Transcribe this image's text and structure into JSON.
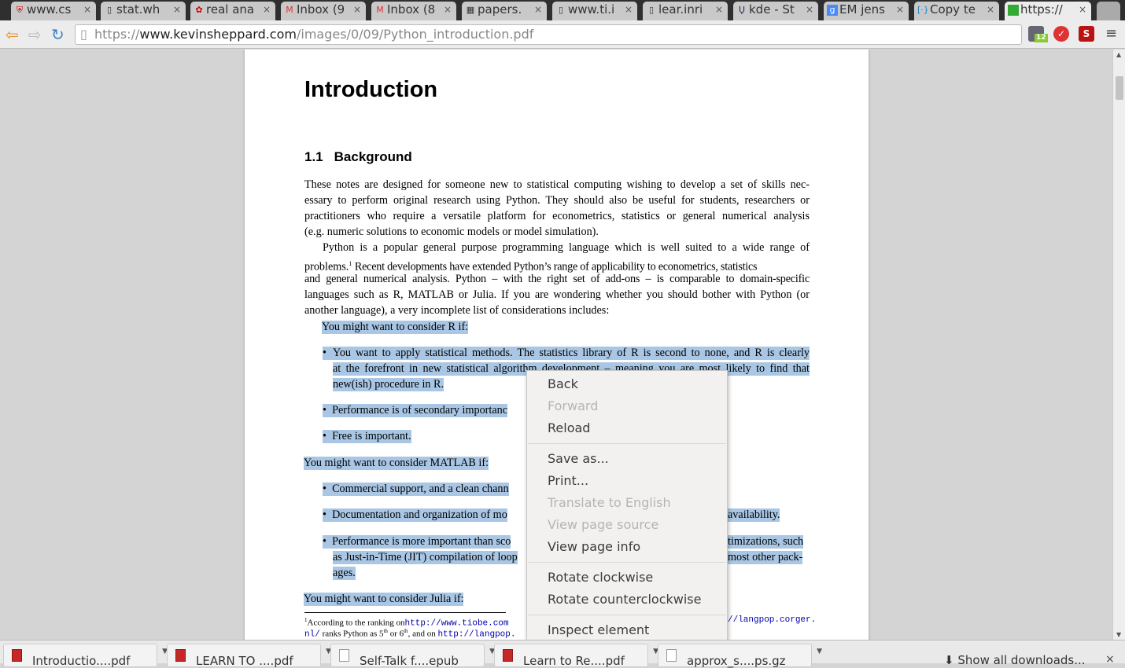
{
  "tabs": [
    {
      "title": "www.cs",
      "icon": "shield-icon"
    },
    {
      "title": "stat.wh",
      "icon": "page-icon"
    },
    {
      "title": "real ana",
      "icon": "flower-icon"
    },
    {
      "title": "Inbox (9",
      "icon": "gmail-icon"
    },
    {
      "title": "Inbox (8",
      "icon": "gmail-icon"
    },
    {
      "title": "papers.",
      "icon": "image-icon"
    },
    {
      "title": "www.ti.i",
      "icon": "page-icon"
    },
    {
      "title": "lear.inri",
      "icon": "page-icon"
    },
    {
      "title": "kde - St",
      "icon": "ul-icon"
    },
    {
      "title": "EM jens",
      "icon": "google-icon"
    },
    {
      "title": "Copy te",
      "icon": "bracket-icon"
    },
    {
      "title": "https://",
      "icon": "green-squares-icon",
      "active": true
    }
  ],
  "address": {
    "scheme": "https://",
    "domain": "www.kevinsheppard.com",
    "path": "/images/0/09/Python_introduction.pdf"
  },
  "extensions": {
    "badge": "12",
    "s_label": "S"
  },
  "doc": {
    "title": "Introduction",
    "section_num": "1.1",
    "section_title": "Background",
    "p1": [
      "These notes are designed for someone new to statistical computing wishing to develop a set of skills nec-",
      "essary to perform original research using Python. They should also be useful for students, researchers or",
      "practitioners who require a versatile platform for econometrics, statistics or general numerical analysis",
      "(e.g. numeric solutions to economic models or model simulation)."
    ],
    "p2": [
      "Python is a popular general purpose programming language which is well suited to a wide range of",
      "problems.",
      "1",
      "Recent developments have extended Python’s range of applicability to econometrics, statistics",
      "and general numerical analysis. Python – with the right set of add-ons – is comparable to domain-specific",
      "languages such as R, MATLAB or Julia. If you are wondering whether you should bother with Python (or",
      "another language), a very incomplete list of considerations includes:"
    ],
    "r_intro": "You might want to consider R if:",
    "r_b1": [
      "You want to apply statistical methods. The statistics library of R is second to none, and R is clearly",
      "at the forefront in new statistical algorithm development – meaning you are most likely to find that",
      "new(ish) procedure in R."
    ],
    "r_b2": "Performance is of secondary importanc",
    "r_b3": "Free is important.",
    "m_intro": "You might want to consider MATLAB if:",
    "m_b1": "Commercial support, and a clean chann",
    "m_b2_l": "Documentation and organization of mo",
    "m_b2_r": "availability.",
    "m_b3_l": [
      "Performance is more important than sco",
      "as Just-in-Time (JIT) compilation of loop",
      "ages."
    ],
    "m_b3_r": [
      "timizations, such",
      "most other pack-"
    ],
    "j_intro": "You might want to consider Julia if:",
    "fn1_a": "According to the ranking on",
    "fn1_url": "http://www.tiobe.com",
    "fn1_url2": "//langpop.corger.",
    "fn2_a": "nl/",
    "fn2_b": " ranks Python as 5",
    "fn2_th": "th",
    "fn2_c": " or 6",
    "fn2_d": ", and on ",
    "fn2_url": "http://langpop."
  },
  "context_menu": [
    "Back",
    "Forward",
    "Reload",
    "Save as...",
    "Print...",
    "Translate to English",
    "View page source",
    "View page info",
    "Rotate clockwise",
    "Rotate counterclockwise",
    "Inspect element"
  ],
  "downloads": [
    {
      "name": "Introductio....pdf",
      "type": "pdf"
    },
    {
      "name": "LEARN TO ....pdf",
      "type": "pdf"
    },
    {
      "name": "Self-Talk f....epub",
      "type": "file"
    },
    {
      "name": "Learn to Re....pdf",
      "type": "pdf"
    },
    {
      "name": "approx_s....ps.gz",
      "type": "file"
    }
  ],
  "show_all": "Show all downloads...",
  "close": "×"
}
